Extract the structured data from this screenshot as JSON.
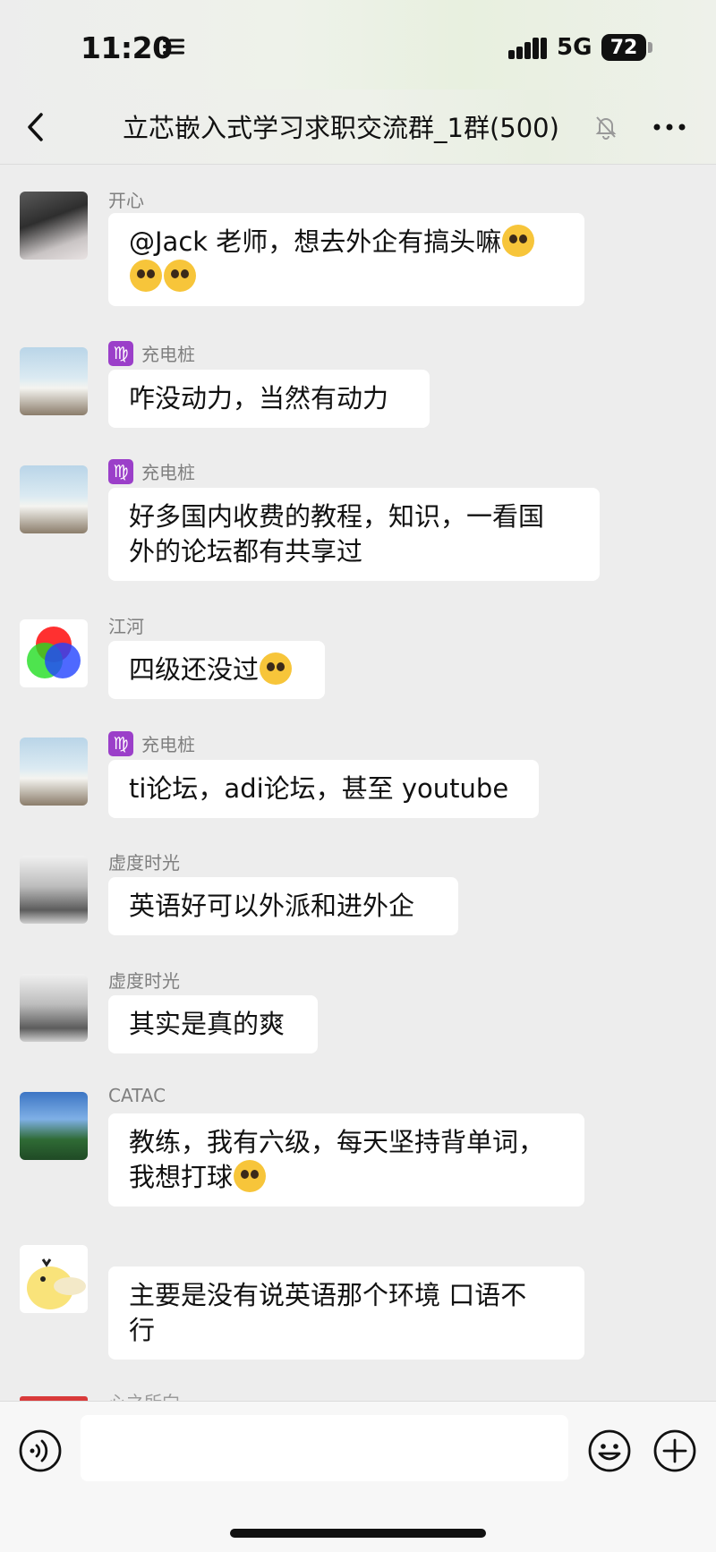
{
  "status": {
    "time": "11:20",
    "network": "5G",
    "battery": "72"
  },
  "header": {
    "title": "立芯嵌入式学习求职交流群_1群(500)"
  },
  "messages": [
    {
      "sender": "开心",
      "text_lines": [
        "@Jack 老师，想去外企有搞头嘛",
        ""
      ]
    },
    {
      "sender": "充电桩",
      "badge": "♍",
      "text_lines": [
        "咋没动力，当然有动力"
      ]
    },
    {
      "sender": "充电桩",
      "badge": "♍",
      "text_lines": [
        "好多国内收费的教程，知识，一看国",
        "外的论坛都有共享过"
      ]
    },
    {
      "sender": "江河",
      "text_lines": [
        "四级还没过"
      ]
    },
    {
      "sender": "充电桩",
      "badge": "♍",
      "text_lines": [
        "ti论坛，adi论坛，甚至 youtube"
      ]
    },
    {
      "sender": "虚度时光",
      "text_lines": [
        "英语好可以外派和进外企"
      ]
    },
    {
      "sender": "虚度时光",
      "text_lines": [
        "其实是真的爽"
      ]
    },
    {
      "sender": "CATAC",
      "text_lines": [
        "教练，我有六级，每天坚持背单词，",
        "我想打球"
      ]
    },
    {
      "sender": "",
      "text_lines": [
        "主要是没有说英语那个环境  口语不",
        "行"
      ]
    }
  ],
  "peek_sender": "心之所向",
  "input": {
    "placeholder": ""
  },
  "icons": {
    "back": "chevron-left-icon",
    "mute": "bell-off-icon",
    "more": "ellipsis-icon",
    "voice": "voice-icon",
    "emoji": "smiley-icon",
    "plus": "plus-circle-icon"
  }
}
